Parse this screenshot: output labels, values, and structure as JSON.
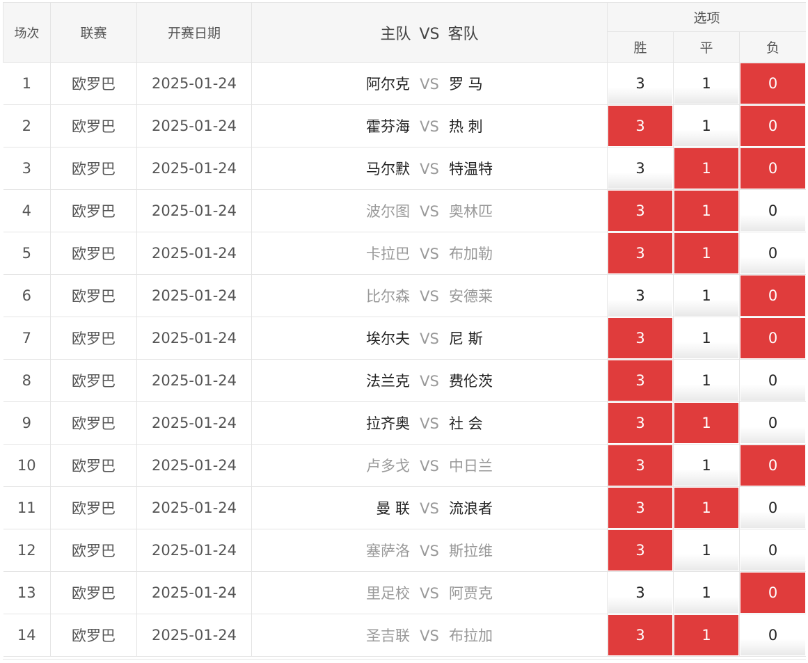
{
  "header": {
    "no": "场次",
    "league": "联赛",
    "date": "开赛日期",
    "home": "主队",
    "vs": "VS",
    "away": "客队",
    "options": "选项",
    "win": "胜",
    "draw": "平",
    "lose": "负"
  },
  "colors": {
    "selected": "#e03c3c",
    "unselected": "#ffffff",
    "border": "#e4e4e4",
    "team_dark": "#222222",
    "team_light": "#999999"
  },
  "rows": [
    {
      "no": "1",
      "league": "欧罗巴",
      "date": "2025-01-24",
      "home": "阿尔克",
      "away": "罗 马",
      "home_style": "dark",
      "away_style": "dark",
      "win": "3",
      "draw": "1",
      "lose": "0",
      "win_on": false,
      "draw_on": false,
      "lose_on": true
    },
    {
      "no": "2",
      "league": "欧罗巴",
      "date": "2025-01-24",
      "home": "霍芬海",
      "away": "热 刺",
      "home_style": "dark",
      "away_style": "dark",
      "win": "3",
      "draw": "1",
      "lose": "0",
      "win_on": true,
      "draw_on": false,
      "lose_on": true
    },
    {
      "no": "3",
      "league": "欧罗巴",
      "date": "2025-01-24",
      "home": "马尔默",
      "away": "特温特",
      "home_style": "dark",
      "away_style": "dark",
      "win": "3",
      "draw": "1",
      "lose": "0",
      "win_on": false,
      "draw_on": true,
      "lose_on": true
    },
    {
      "no": "4",
      "league": "欧罗巴",
      "date": "2025-01-24",
      "home": "波尔图",
      "away": "奥林匹",
      "home_style": "light",
      "away_style": "light",
      "win": "3",
      "draw": "1",
      "lose": "0",
      "win_on": true,
      "draw_on": true,
      "lose_on": false
    },
    {
      "no": "5",
      "league": "欧罗巴",
      "date": "2025-01-24",
      "home": "卡拉巴",
      "away": "布加勒",
      "home_style": "light",
      "away_style": "light",
      "win": "3",
      "draw": "1",
      "lose": "0",
      "win_on": true,
      "draw_on": true,
      "lose_on": false
    },
    {
      "no": "6",
      "league": "欧罗巴",
      "date": "2025-01-24",
      "home": "比尔森",
      "away": "安德莱",
      "home_style": "light",
      "away_style": "light",
      "win": "3",
      "draw": "1",
      "lose": "0",
      "win_on": false,
      "draw_on": false,
      "lose_on": true
    },
    {
      "no": "7",
      "league": "欧罗巴",
      "date": "2025-01-24",
      "home": "埃尔夫",
      "away": "尼 斯",
      "home_style": "dark",
      "away_style": "dark",
      "win": "3",
      "draw": "1",
      "lose": "0",
      "win_on": true,
      "draw_on": false,
      "lose_on": true
    },
    {
      "no": "8",
      "league": "欧罗巴",
      "date": "2025-01-24",
      "home": "法兰克",
      "away": "费伦茨",
      "home_style": "dark",
      "away_style": "dark",
      "win": "3",
      "draw": "1",
      "lose": "0",
      "win_on": true,
      "draw_on": false,
      "lose_on": false
    },
    {
      "no": "9",
      "league": "欧罗巴",
      "date": "2025-01-24",
      "home": "拉齐奥",
      "away": "社 会",
      "home_style": "dark",
      "away_style": "dark",
      "win": "3",
      "draw": "1",
      "lose": "0",
      "win_on": true,
      "draw_on": true,
      "lose_on": false
    },
    {
      "no": "10",
      "league": "欧罗巴",
      "date": "2025-01-24",
      "home": "卢多戈",
      "away": "中日兰",
      "home_style": "light",
      "away_style": "light",
      "win": "3",
      "draw": "1",
      "lose": "0",
      "win_on": true,
      "draw_on": false,
      "lose_on": true
    },
    {
      "no": "11",
      "league": "欧罗巴",
      "date": "2025-01-24",
      "home": "曼 联",
      "away": "流浪者",
      "home_style": "dark",
      "away_style": "dark",
      "win": "3",
      "draw": "1",
      "lose": "0",
      "win_on": true,
      "draw_on": true,
      "lose_on": false
    },
    {
      "no": "12",
      "league": "欧罗巴",
      "date": "2025-01-24",
      "home": "塞萨洛",
      "away": "斯拉维",
      "home_style": "light",
      "away_style": "light",
      "win": "3",
      "draw": "1",
      "lose": "0",
      "win_on": true,
      "draw_on": false,
      "lose_on": false
    },
    {
      "no": "13",
      "league": "欧罗巴",
      "date": "2025-01-24",
      "home": "里足校",
      "away": "阿贾克",
      "home_style": "light",
      "away_style": "light",
      "win": "3",
      "draw": "1",
      "lose": "0",
      "win_on": false,
      "draw_on": false,
      "lose_on": true
    },
    {
      "no": "14",
      "league": "欧罗巴",
      "date": "2025-01-24",
      "home": "圣吉联",
      "away": "布拉加",
      "home_style": "light",
      "away_style": "light",
      "win": "3",
      "draw": "1",
      "lose": "0",
      "win_on": true,
      "draw_on": true,
      "lose_on": false
    }
  ]
}
